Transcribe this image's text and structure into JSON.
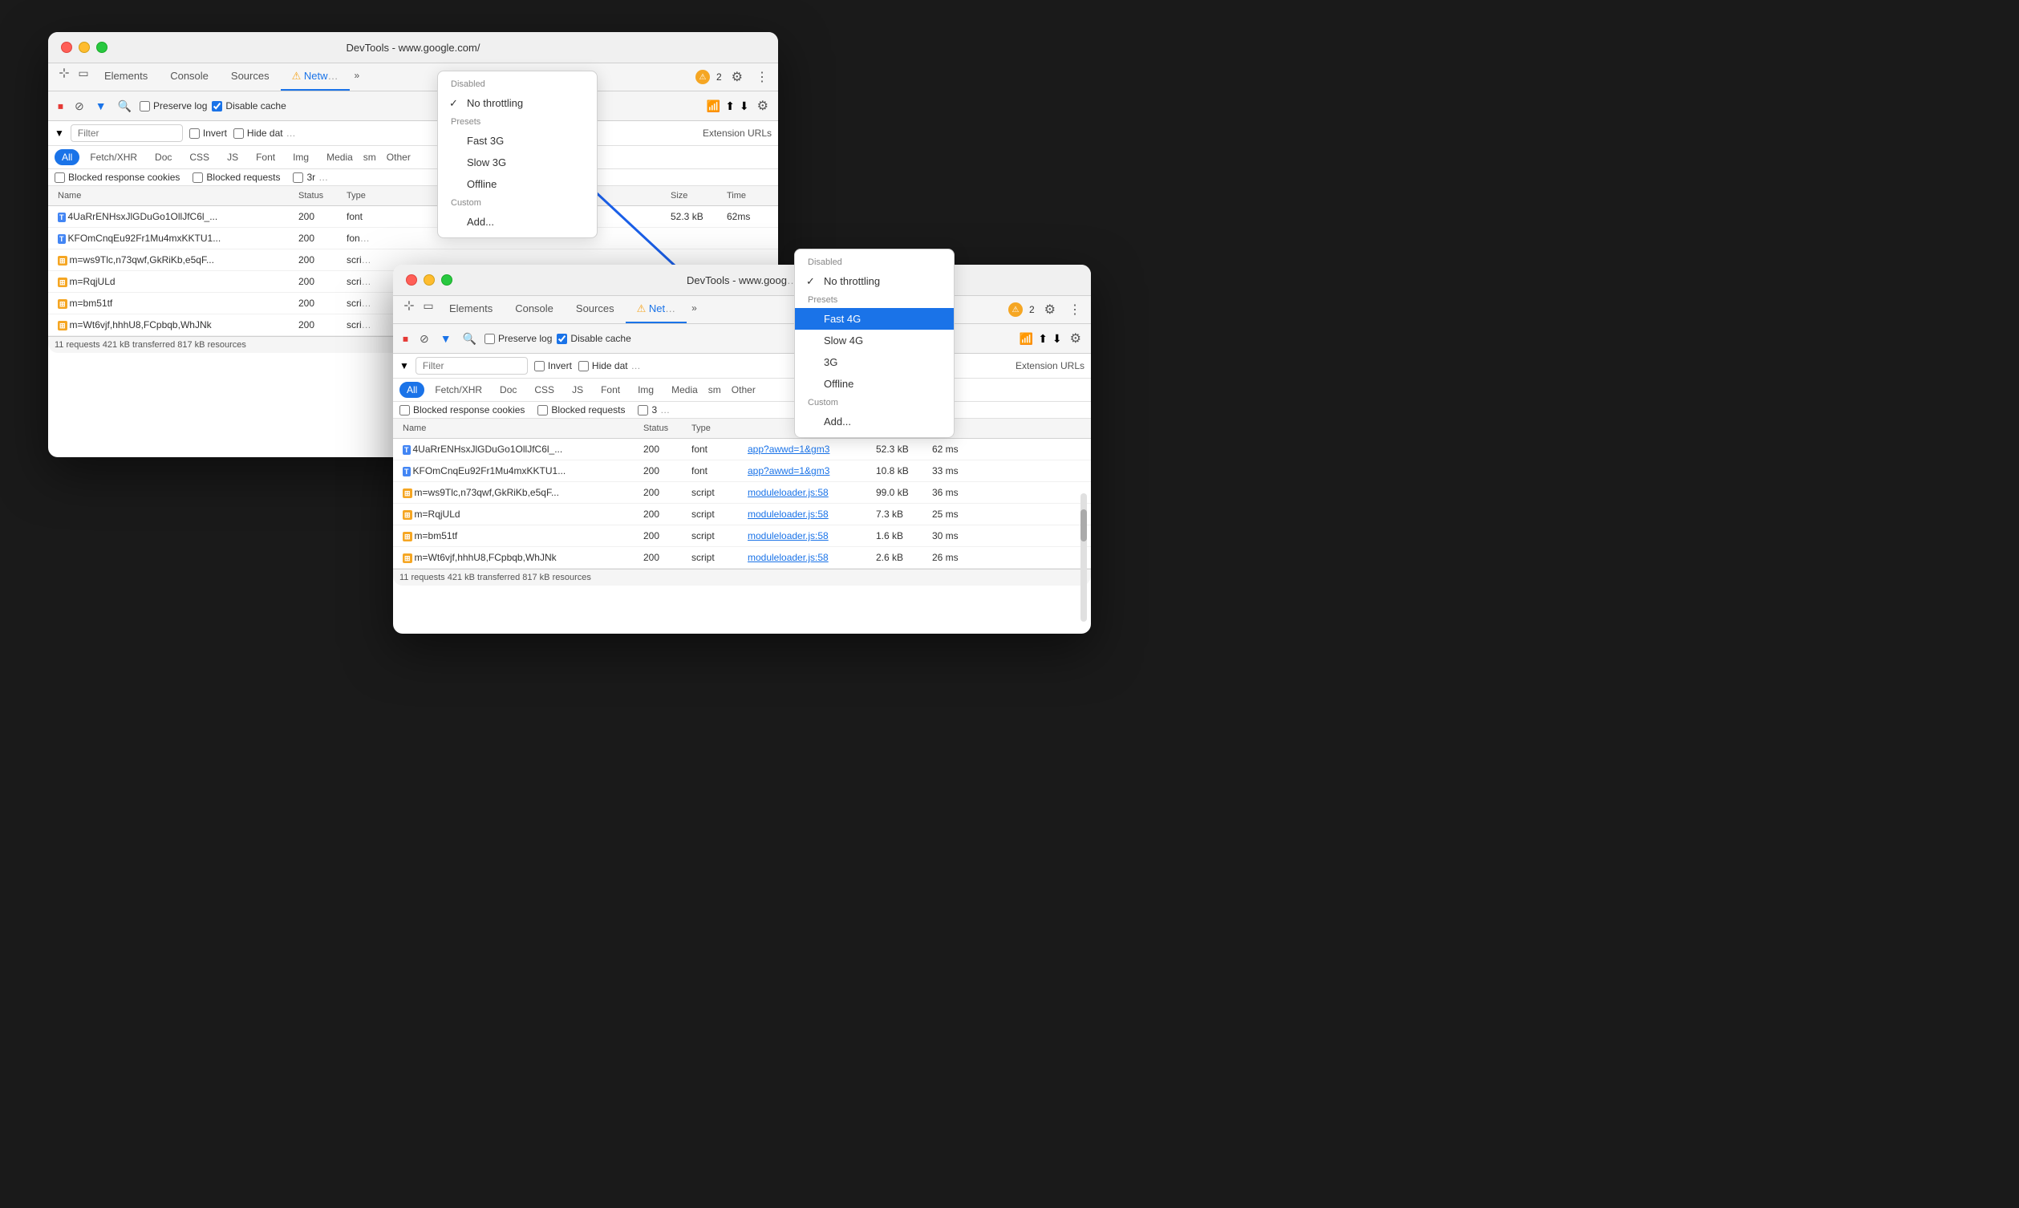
{
  "window1": {
    "title": "DevTools - www.google.com/",
    "tabs": [
      "Elements",
      "Console",
      "Sources",
      "Network"
    ],
    "activeTab": "Network",
    "toolbar": {
      "preserveLog": false,
      "disableCache": true,
      "throttle": "No throttling"
    },
    "filter": {
      "placeholder": "Filter",
      "invert": false,
      "hideData": false
    },
    "typeFilters": [
      "All",
      "Fetch/XHR",
      "Doc",
      "CSS",
      "JS",
      "Font",
      "Img",
      "Media",
      "Other"
    ],
    "activeFilter": "All",
    "rows": [
      {
        "icon": "font",
        "name": "4UaRrENHsxJlGDuGo1OllJfC6l_...",
        "status": "200",
        "type": "font",
        "size": "52.3 kB",
        "time": "62ms"
      },
      {
        "icon": "font",
        "name": "KFOmCnqEu92Fr1Mu4mxKKTU1...",
        "status": "200",
        "type": "font",
        "size": "",
        "time": ""
      },
      {
        "icon": "script",
        "name": "m=ws9Tlc,n73qwf,GkRiKb,e5qF...",
        "status": "200",
        "type": "script",
        "size": "",
        "time": ""
      },
      {
        "icon": "script",
        "name": "m=RqjULd",
        "status": "200",
        "type": "script",
        "size": "",
        "time": ""
      },
      {
        "icon": "script",
        "name": "m=bm51tf",
        "status": "200",
        "type": "script",
        "size": "",
        "time": ""
      },
      {
        "icon": "script",
        "name": "m=Wt6vjf,hhhU8,FCpbqb,WhJNk",
        "status": "200",
        "type": "script",
        "size": "",
        "time": ""
      }
    ],
    "statusBar": "11 requests   421 kB transferred   817 kB resources"
  },
  "dropdown1": {
    "disabled": "Disabled",
    "noThrottling": "No throttling",
    "presets": "Presets",
    "items": [
      "Fast 3G",
      "Slow 3G",
      "Offline"
    ],
    "custom": "Custom",
    "addItem": "Add..."
  },
  "window2": {
    "title": "DevTools - www.google.com/",
    "tabs": [
      "Elements",
      "Console",
      "Sources",
      "Network"
    ],
    "activeTab": "Network",
    "toolbar": {
      "preserveLog": false,
      "disableCache": true,
      "throttle": "Fast 4G"
    },
    "filter": {
      "placeholder": "Filter",
      "invert": false,
      "hideData": false
    },
    "typeFilters": [
      "All",
      "Fetch/XHR",
      "Doc",
      "CSS",
      "JS",
      "Font",
      "Img",
      "Media",
      "Other"
    ],
    "activeFilter": "All",
    "rows": [
      {
        "icon": "font",
        "name": "4UaRrENHsxJlGDuGo1OllJfC6l_...",
        "status": "200",
        "type": "font",
        "initiator": "app?awwd=1&gm3",
        "size": "52.3 kB",
        "time": "62 ms"
      },
      {
        "icon": "font",
        "name": "KFOmCnqEu92Fr1Mu4mxKKTU1...",
        "status": "200",
        "type": "font",
        "initiator": "app?awwd=1&gm3",
        "size": "10.8 kB",
        "time": "33 ms"
      },
      {
        "icon": "script",
        "name": "m=ws9Tlc,n73qwf,GkRiKb,e5qF...",
        "status": "200",
        "type": "script",
        "initiator": "moduleloader.js:58",
        "size": "99.0 kB",
        "time": "36 ms"
      },
      {
        "icon": "script",
        "name": "m=RqjULd",
        "status": "200",
        "type": "script",
        "initiator": "moduleloader.js:58",
        "size": "7.3 kB",
        "time": "25 ms"
      },
      {
        "icon": "script",
        "name": "m=bm51tf",
        "status": "200",
        "type": "script",
        "initiator": "moduleloader.js:58",
        "size": "1.6 kB",
        "time": "30 ms"
      },
      {
        "icon": "script",
        "name": "m=Wt6vjf,hhhU8,FCpbqb,WhJNk",
        "status": "200",
        "type": "script",
        "initiator": "moduleloader.js:58",
        "size": "2.6 kB",
        "time": "26 ms"
      }
    ],
    "statusBar": "11 requests   421 kB transferred   817 kB resources"
  },
  "dropdown2": {
    "disabled": "Disabled",
    "noThrottling": "No throttling",
    "presets": "Presets",
    "items": [
      "Fast 4G",
      "Slow 4G",
      "3G",
      "Offline"
    ],
    "custom": "Custom",
    "addItem": "Add..."
  },
  "arrow": {
    "label": "arrow pointing from menu1 to menu2"
  }
}
